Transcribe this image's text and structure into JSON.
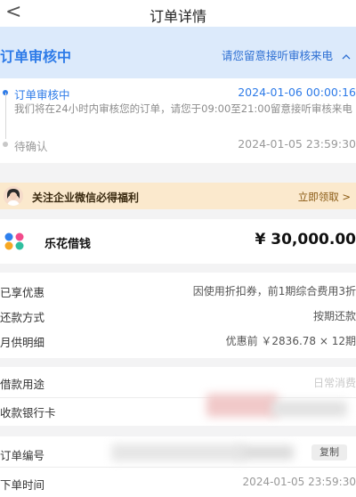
{
  "nav": {
    "back_icon": "<",
    "title": "订单详情"
  },
  "status": {
    "title": "订单审核中",
    "hint": "请您留意接听审核来电",
    "hint_icon": "chevron-up-icon"
  },
  "timeline": [
    {
      "title": "订单审核中",
      "time": "2024-01-06 00:00:16",
      "desc": "我们将在24小时内审核您的订单，请您于09:00至21:00留意接听审核来电"
    },
    {
      "title": "待确认",
      "time": "2024-01-05 23:59:30"
    }
  ],
  "banner": {
    "text": "关注企业微信必得福利",
    "action": "立即领取 >"
  },
  "loan": {
    "name": "乐花借钱",
    "amount": "¥ 30,000.00"
  },
  "details": [
    {
      "label": "已享优惠",
      "value": "因使用折扣券，前1期综合费用3折"
    },
    {
      "label": "还款方式",
      "value": "按期还款"
    },
    {
      "label": "月供明细",
      "value": "优惠前 ￥2836.78 × 12期"
    }
  ],
  "loan_info": [
    {
      "label": "借款用途",
      "value": "日常消费"
    },
    {
      "label": "收款银行卡",
      "value": ""
    }
  ],
  "order": {
    "number_label": "订单编号",
    "copy_label": "复制",
    "time_label": "下单时间",
    "time_value": "2024-01-05 23:59:30"
  },
  "colors": {
    "accent_blue": "#2e7be8",
    "status_bg": "#dceafb",
    "banner_bg": "#fbe9cd"
  }
}
